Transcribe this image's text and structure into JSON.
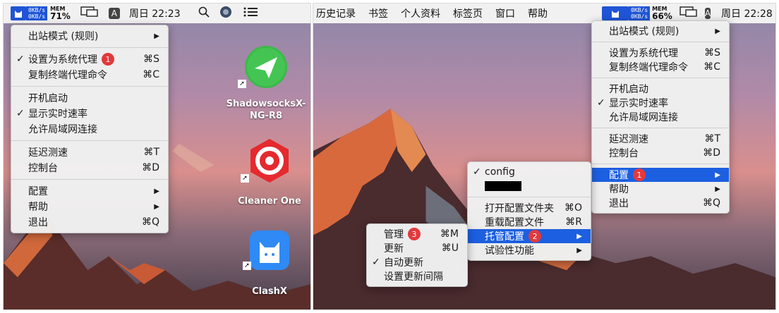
{
  "left": {
    "menubar": {
      "speed_up": "0KB/s",
      "speed_down": "0KB/s",
      "mem_label": "MEM",
      "mem_pct": "71%",
      "input_badge": "A",
      "clock": "周日 22:23"
    },
    "menu": {
      "outbound_mode": "出站模式 (规则)",
      "set_system_proxy": "设置为系统代理",
      "set_system_proxy_badge": "1",
      "set_system_proxy_shortcut": "⌘S",
      "copy_terminal": "复制终端代理命令",
      "copy_terminal_shortcut": "⌘C",
      "launch_at_login": "开机启动",
      "show_speed": "显示实时速率",
      "allow_lan": "允许局域网连接",
      "latency_test": "延迟测速",
      "latency_test_shortcut": "⌘T",
      "console": "控制台",
      "console_shortcut": "⌘D",
      "config": "配置",
      "help": "帮助",
      "quit": "退出",
      "quit_shortcut": "⌘Q"
    },
    "desktop_icons": {
      "shadowsocks_line1": "ShadowsocksX-",
      "shadowsocks_line2": "NG-R8",
      "cleaner": "Cleaner One",
      "clashx": "ClashX"
    }
  },
  "right": {
    "menubar": {
      "items": [
        "历史记录",
        "书签",
        "个人资料",
        "标签页",
        "窗口",
        "帮助"
      ],
      "speed_up": "0KB/s",
      "speed_down": "0KB/s",
      "mem_label": "MEM",
      "mem_pct": "66%",
      "input_badge": "A",
      "clock": "周日 22:28"
    },
    "menu": {
      "outbound_mode": "出站模式 (规则)",
      "set_system_proxy": "设置为系统代理",
      "set_system_proxy_shortcut": "⌘S",
      "copy_terminal": "复制终端代理命令",
      "copy_terminal_shortcut": "⌘C",
      "launch_at_login": "开机启动",
      "show_speed": "显示实时速率",
      "allow_lan": "允许局域网连接",
      "latency_test": "延迟测速",
      "latency_test_shortcut": "⌘T",
      "console": "控制台",
      "console_shortcut": "⌘D",
      "config": "配置",
      "config_badge": "1",
      "help": "帮助",
      "quit": "退出",
      "quit_shortcut": "⌘Q"
    },
    "config_submenu": {
      "config_item": "config",
      "open_folder": "打开配置文件夹",
      "open_folder_shortcut": "⌘O",
      "reload": "重载配置文件",
      "reload_shortcut": "⌘R",
      "managed": "托管配置",
      "managed_badge": "2",
      "experimental": "试验性功能"
    },
    "managed_submenu": {
      "manage": "管理",
      "manage_badge": "3",
      "manage_shortcut": "⌘M",
      "update": "更新",
      "update_shortcut": "⌘U",
      "auto_update": "自动更新",
      "update_interval": "设置更新间隔"
    }
  },
  "colors": {
    "highlight": "#1c5fe0",
    "badge": "#e3393c",
    "status_blue": "#1f55d6"
  }
}
